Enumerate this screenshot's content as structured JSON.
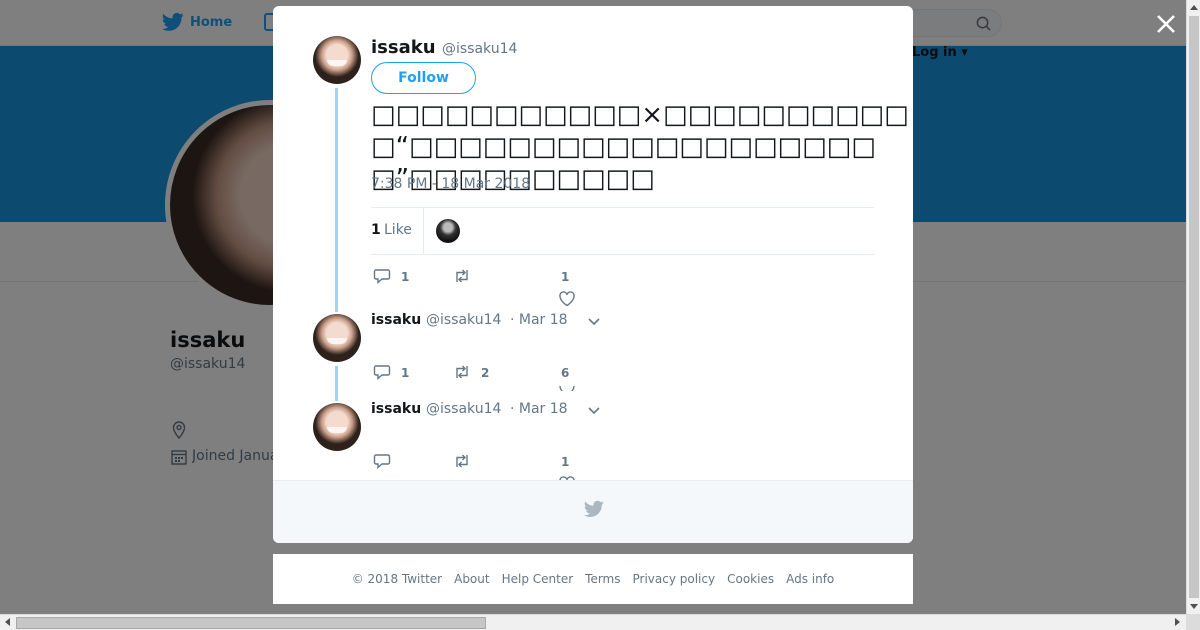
{
  "nav": {
    "home_label": "Home",
    "login_label": "Log in ▾"
  },
  "profile": {
    "name": "issaku",
    "handle": "@issaku14",
    "joined": "Joined January"
  },
  "tweet": {
    "name": "issaku",
    "handle": "@issaku14",
    "follow_label": "Follow",
    "text": "□□□□□□□□□□□×□□□□□□□□□□□“□□□□□□□□□□□□□□□□□□□□”□□□□□□□□□□",
    "timestamp": "7:38 PM - 18 Mar 2018",
    "likes_count": "1",
    "likes_label": "Like",
    "actions": {
      "replies": "1",
      "retweets": "",
      "likes": "1"
    }
  },
  "replies": [
    {
      "name": "issaku",
      "handle": "@issaku14",
      "date": "· Mar 18",
      "replies": "1",
      "retweets": "2",
      "likes": "6"
    },
    {
      "name": "issaku",
      "handle": "@issaku14",
      "date": "· Mar 18",
      "replies": "",
      "retweets": "",
      "likes": "1"
    }
  ],
  "footer": {
    "copyright": "© 2018 Twitter",
    "about": "About",
    "help": "Help Center",
    "terms": "Terms",
    "privacy": "Privacy policy",
    "cookies": "Cookies",
    "ads": "Ads info"
  },
  "colors": {
    "brand": "#1da1f2",
    "banner": "#1b95e0",
    "thread_line": "#9bd4f6",
    "muted": "#657786"
  },
  "icons": [
    "twitter-bird-icon",
    "search-icon",
    "close-icon",
    "reply-icon",
    "retweet-icon",
    "heart-icon",
    "chevron-down-icon",
    "location-icon",
    "calendar-icon"
  ]
}
